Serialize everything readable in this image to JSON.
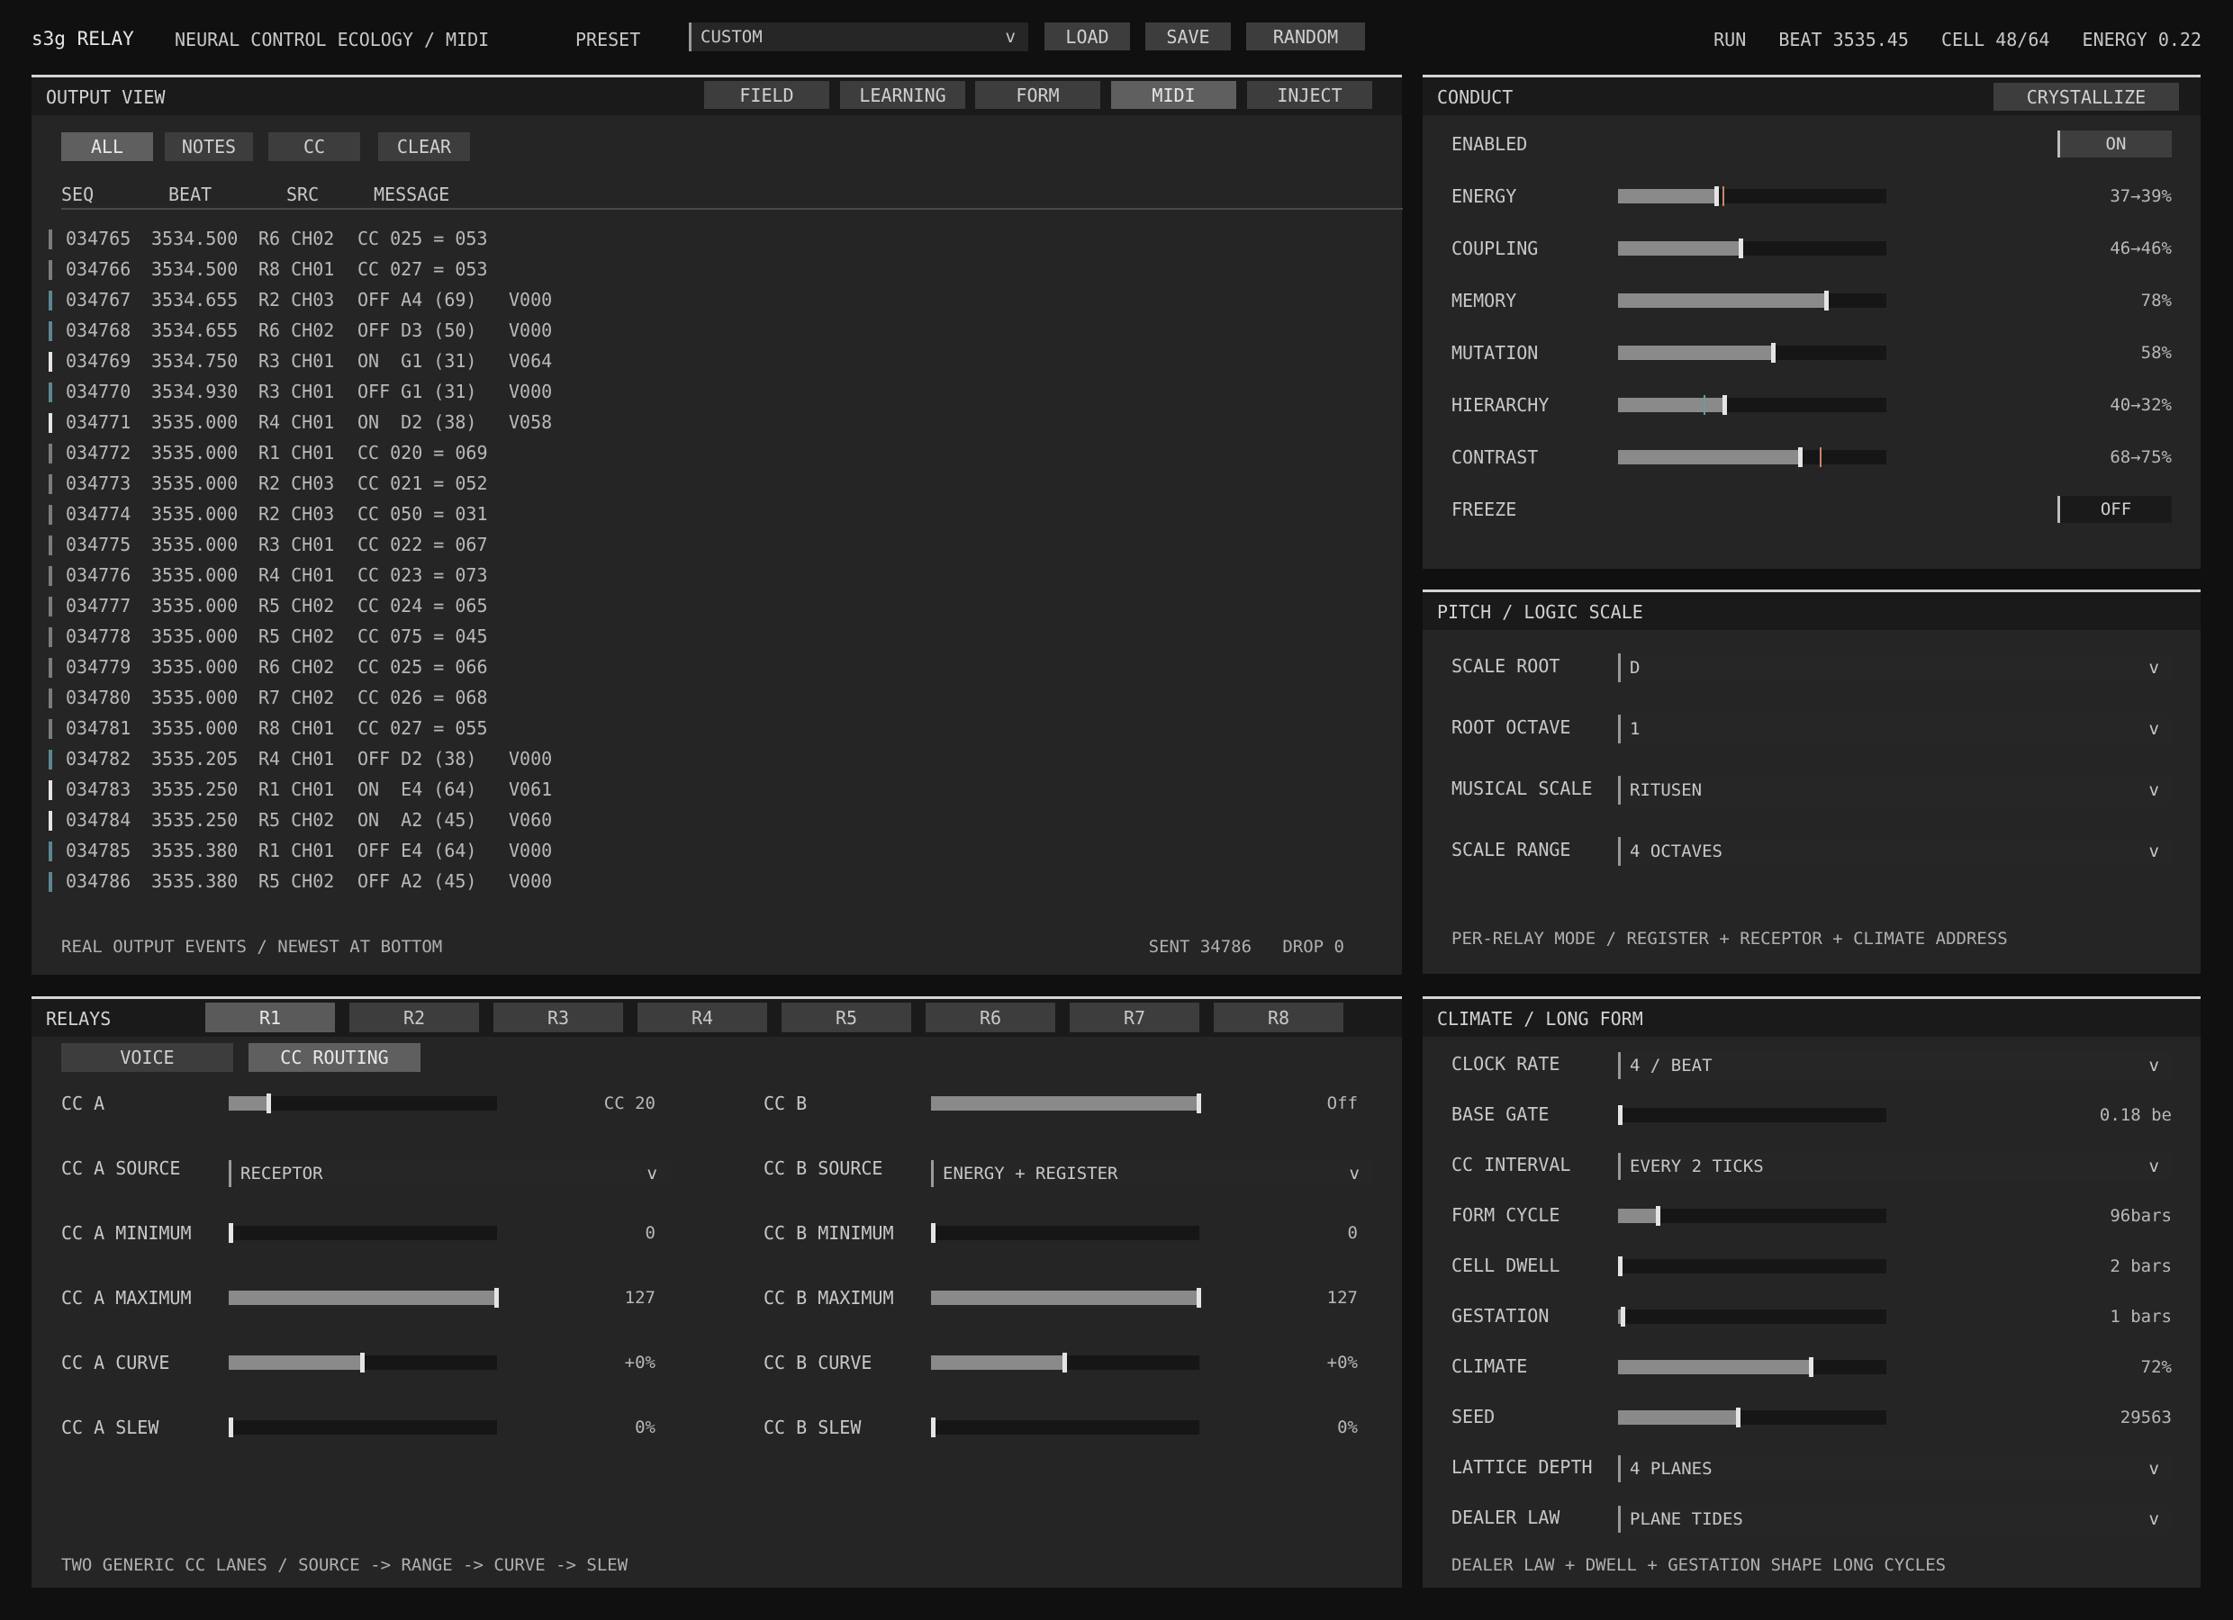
{
  "app": {
    "name": "s3g RELAY",
    "subtitle": "NEURAL CONTROL ECOLOGY / MIDI",
    "preset_label": "PRESET",
    "preset_value": "CUSTOM",
    "load": "LOAD",
    "save": "SAVE",
    "random": "RANDOM",
    "status": "RUN   BEAT 3535.45   CELL 48/64   ENERGY 0.22"
  },
  "output": {
    "title": "OUTPUT VIEW",
    "tabs": [
      "FIELD",
      "LEARNING",
      "FORM",
      "MIDI",
      "INJECT"
    ],
    "active_tab": "MIDI",
    "filters": [
      "ALL",
      "NOTES",
      "CC"
    ],
    "clear": "CLEAR",
    "active_filter": "ALL",
    "headers": [
      "SEQ",
      "BEAT",
      "SRC",
      "MESSAGE"
    ],
    "rows": [
      {
        "seq": "034765",
        "beat": "3534.500",
        "src": "R6 CH02",
        "msg": "CC 025 = 053",
        "vel": "",
        "kind": "cc"
      },
      {
        "seq": "034766",
        "beat": "3534.500",
        "src": "R8 CH01",
        "msg": "CC 027 = 053",
        "vel": "",
        "kind": "cc"
      },
      {
        "seq": "034767",
        "beat": "3534.655",
        "src": "R2 CH03",
        "msg": "OFF A4 (69)",
        "vel": "V000",
        "kind": "off"
      },
      {
        "seq": "034768",
        "beat": "3534.655",
        "src": "R6 CH02",
        "msg": "OFF D3 (50)",
        "vel": "V000",
        "kind": "off"
      },
      {
        "seq": "034769",
        "beat": "3534.750",
        "src": "R3 CH01",
        "msg": "ON  G1 (31)",
        "vel": "V064",
        "kind": "on"
      },
      {
        "seq": "034770",
        "beat": "3534.930",
        "src": "R3 CH01",
        "msg": "OFF G1 (31)",
        "vel": "V000",
        "kind": "off"
      },
      {
        "seq": "034771",
        "beat": "3535.000",
        "src": "R4 CH01",
        "msg": "ON  D2 (38)",
        "vel": "V058",
        "kind": "on"
      },
      {
        "seq": "034772",
        "beat": "3535.000",
        "src": "R1 CH01",
        "msg": "CC 020 = 069",
        "vel": "",
        "kind": "cc"
      },
      {
        "seq": "034773",
        "beat": "3535.000",
        "src": "R2 CH03",
        "msg": "CC 021 = 052",
        "vel": "",
        "kind": "cc"
      },
      {
        "seq": "034774",
        "beat": "3535.000",
        "src": "R2 CH03",
        "msg": "CC 050 = 031",
        "vel": "",
        "kind": "cc"
      },
      {
        "seq": "034775",
        "beat": "3535.000",
        "src": "R3 CH01",
        "msg": "CC 022 = 067",
        "vel": "",
        "kind": "cc"
      },
      {
        "seq": "034776",
        "beat": "3535.000",
        "src": "R4 CH01",
        "msg": "CC 023 = 073",
        "vel": "",
        "kind": "cc"
      },
      {
        "seq": "034777",
        "beat": "3535.000",
        "src": "R5 CH02",
        "msg": "CC 024 = 065",
        "vel": "",
        "kind": "cc"
      },
      {
        "seq": "034778",
        "beat": "3535.000",
        "src": "R5 CH02",
        "msg": "CC 075 = 045",
        "vel": "",
        "kind": "cc"
      },
      {
        "seq": "034779",
        "beat": "3535.000",
        "src": "R6 CH02",
        "msg": "CC 025 = 066",
        "vel": "",
        "kind": "cc"
      },
      {
        "seq": "034780",
        "beat": "3535.000",
        "src": "R7 CH02",
        "msg": "CC 026 = 068",
        "vel": "",
        "kind": "cc"
      },
      {
        "seq": "034781",
        "beat": "3535.000",
        "src": "R8 CH01",
        "msg": "CC 027 = 055",
        "vel": "",
        "kind": "cc"
      },
      {
        "seq": "034782",
        "beat": "3535.205",
        "src": "R4 CH01",
        "msg": "OFF D2 (38)",
        "vel": "V000",
        "kind": "off"
      },
      {
        "seq": "034783",
        "beat": "3535.250",
        "src": "R1 CH01",
        "msg": "ON  E4 (64)",
        "vel": "V061",
        "kind": "on"
      },
      {
        "seq": "034784",
        "beat": "3535.250",
        "src": "R5 CH02",
        "msg": "ON  A2 (45)",
        "vel": "V060",
        "kind": "on"
      },
      {
        "seq": "034785",
        "beat": "3535.380",
        "src": "R1 CH01",
        "msg": "OFF E4 (64)",
        "vel": "V000",
        "kind": "off"
      },
      {
        "seq": "034786",
        "beat": "3535.380",
        "src": "R5 CH02",
        "msg": "OFF A2 (45)",
        "vel": "V000",
        "kind": "off"
      }
    ],
    "footer_left": "REAL OUTPUT EVENTS / NEWEST AT BOTTOM",
    "footer_right": "SENT 34786   DROP 0"
  },
  "conduct": {
    "title": "CONDUCT",
    "crystallize": "CRYSTALLIZE",
    "enabled_label": "ENABLED",
    "enabled_value": "ON",
    "freeze_label": "FREEZE",
    "freeze_value": "OFF",
    "params": [
      {
        "label": "ENERGY",
        "value": "37→39%",
        "level": 0.37,
        "target": 0.39
      },
      {
        "label": "COUPLING",
        "value": "46→46%",
        "level": 0.46,
        "target": 0.46
      },
      {
        "label": "MEMORY",
        "value": "78%",
        "level": 0.78,
        "target": null
      },
      {
        "label": "MUTATION",
        "value": "58%",
        "level": 0.58,
        "target": null
      },
      {
        "label": "HIERARCHY",
        "value": "40→32%",
        "level": 0.4,
        "target": 0.32
      },
      {
        "label": "CONTRAST",
        "value": "68→75%",
        "level": 0.68,
        "target": 0.75
      }
    ]
  },
  "pitch": {
    "title": "PITCH / LOGIC SCALE",
    "fields": [
      {
        "label": "SCALE ROOT",
        "value": "D"
      },
      {
        "label": "ROOT OCTAVE",
        "value": "1"
      },
      {
        "label": "MUSICAL SCALE",
        "value": "RITUSEN"
      },
      {
        "label": "SCALE RANGE",
        "value": "4 OCTAVES"
      }
    ],
    "note": "PER-RELAY MODE / REGISTER + RECEPTOR + CLIMATE ADDRESS"
  },
  "relays": {
    "title": "RELAYS",
    "tabs": [
      "R1",
      "R2",
      "R3",
      "R4",
      "R5",
      "R6",
      "R7",
      "R8"
    ],
    "active_tab": "R1",
    "subtabs": [
      "VOICE",
      "CC ROUTING"
    ],
    "active_subtab": "CC ROUTING",
    "lane_a": [
      {
        "label": "CC A",
        "type": "slider",
        "level": 0.15,
        "value": "CC 20"
      },
      {
        "label": "CC A SOURCE",
        "type": "select",
        "value": "RECEPTOR"
      },
      {
        "label": "CC A MINIMUM",
        "type": "slider",
        "level": 0.0,
        "value": "0"
      },
      {
        "label": "CC A MAXIMUM",
        "type": "slider",
        "level": 1.0,
        "value": "127"
      },
      {
        "label": "CC A CURVE",
        "type": "slider",
        "level": 0.5,
        "value": "+0%"
      },
      {
        "label": "CC A SLEW",
        "type": "slider",
        "level": 0.0,
        "value": "0%"
      }
    ],
    "lane_b": [
      {
        "label": "CC B",
        "type": "slider",
        "level": 1.0,
        "value": "Off"
      },
      {
        "label": "CC B SOURCE",
        "type": "select",
        "value": "ENERGY + REGISTER"
      },
      {
        "label": "CC B MINIMUM",
        "type": "slider",
        "level": 0.0,
        "value": "0"
      },
      {
        "label": "CC B MAXIMUM",
        "type": "slider",
        "level": 1.0,
        "value": "127"
      },
      {
        "label": "CC B CURVE",
        "type": "slider",
        "level": 0.5,
        "value": "+0%"
      },
      {
        "label": "CC B SLEW",
        "type": "slider",
        "level": 0.0,
        "value": "0%"
      }
    ],
    "note": "TWO GENERIC CC LANES / SOURCE -> RANGE -> CURVE -> SLEW"
  },
  "climate": {
    "title": "CLIMATE / LONG FORM",
    "rows": [
      {
        "label": "CLOCK RATE",
        "type": "select",
        "value": "4 / BEAT"
      },
      {
        "label": "BASE GATE",
        "type": "slider",
        "level": 0.0,
        "value": "0.18 be"
      },
      {
        "label": "CC INTERVAL",
        "type": "select",
        "value": "EVERY 2 TICKS"
      },
      {
        "label": "FORM CYCLE",
        "type": "slider",
        "level": 0.15,
        "value": "96bars"
      },
      {
        "label": "CELL DWELL",
        "type": "slider",
        "level": 0.0,
        "value": "2 bars"
      },
      {
        "label": "GESTATION",
        "type": "slider",
        "level": 0.02,
        "value": "1 bars"
      },
      {
        "label": "CLIMATE",
        "type": "slider",
        "level": 0.72,
        "value": "72%"
      },
      {
        "label": "SEED",
        "type": "slider",
        "level": 0.45,
        "value": "29563"
      },
      {
        "label": "LATTICE DEPTH",
        "type": "select",
        "value": "4 PLANES"
      },
      {
        "label": "DEALER LAW",
        "type": "select",
        "value": "PLANE TIDES"
      }
    ],
    "note": "DEALER LAW + DWELL + GESTATION SHAPE LONG CYCLES"
  },
  "colors": {
    "cc_marker": "#7c7c7c",
    "off_marker": "#5e8592",
    "on_marker": "#e4e4e4",
    "target_up": "#c8866a",
    "target_down": "#6d9aa0"
  }
}
